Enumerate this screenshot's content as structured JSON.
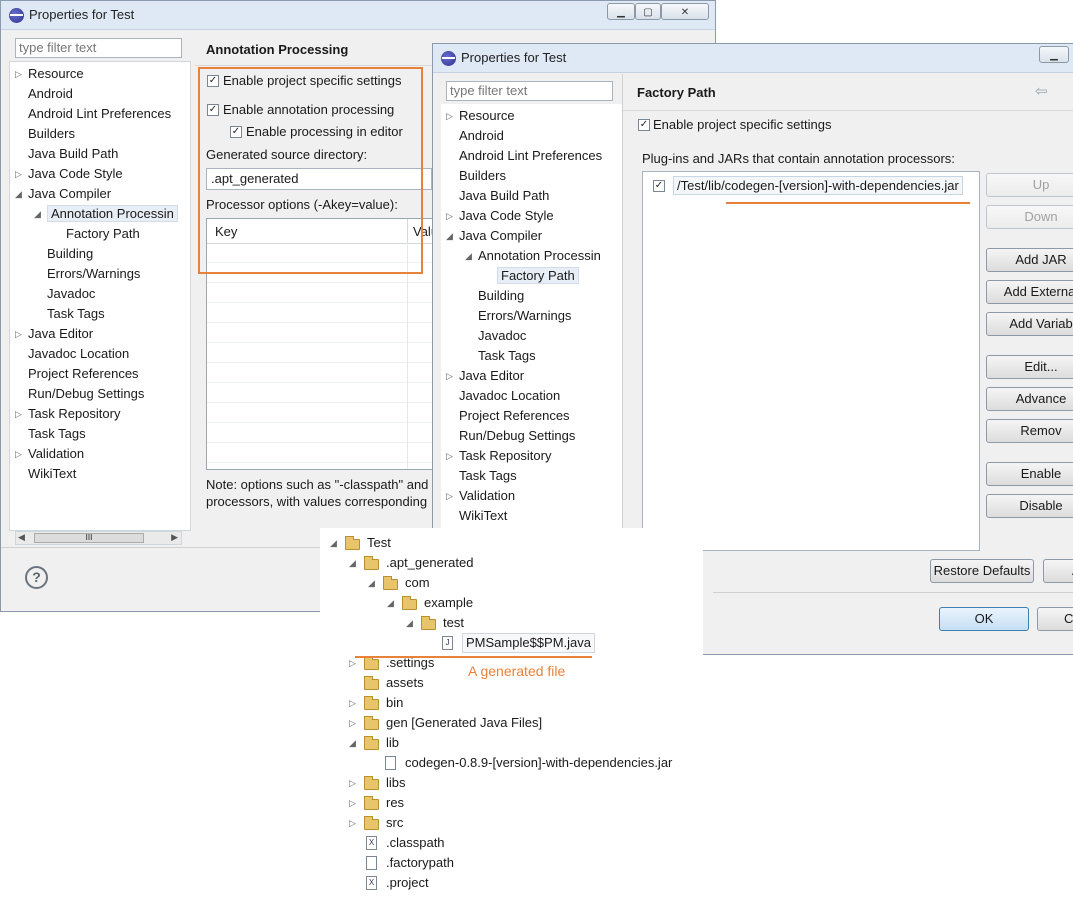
{
  "back_window": {
    "title": "Properties for Test",
    "filter_placeholder": "type filter text",
    "tree": [
      {
        "label": "Resource",
        "arrow": "▷"
      },
      {
        "label": "Android",
        "arrow": ""
      },
      {
        "label": "Android Lint Preferences",
        "arrow": ""
      },
      {
        "label": "Builders",
        "arrow": ""
      },
      {
        "label": "Java Build Path",
        "arrow": ""
      },
      {
        "label": "Java Code Style",
        "arrow": "▷"
      },
      {
        "label": "Java Compiler",
        "arrow": "◢"
      },
      {
        "label": "Annotation Processin",
        "arrow": "◢"
      },
      {
        "label": "Factory Path",
        "arrow": ""
      },
      {
        "label": "Building",
        "arrow": ""
      },
      {
        "label": "Errors/Warnings",
        "arrow": ""
      },
      {
        "label": "Javadoc",
        "arrow": ""
      },
      {
        "label": "Task Tags",
        "arrow": ""
      },
      {
        "label": "Java Editor",
        "arrow": "▷"
      },
      {
        "label": "Javadoc Location",
        "arrow": ""
      },
      {
        "label": "Project References",
        "arrow": ""
      },
      {
        "label": "Run/Debug Settings",
        "arrow": ""
      },
      {
        "label": "Task Repository",
        "arrow": "▷"
      },
      {
        "label": "Task Tags",
        "arrow": ""
      },
      {
        "label": "Validation",
        "arrow": "▷"
      },
      {
        "label": "WikiText",
        "arrow": ""
      }
    ],
    "panel_title": "Annotation Processing",
    "enable_project_specific": "Enable project specific settings",
    "enable_annotation": "Enable annotation processing",
    "enable_in_editor": "Enable processing in editor",
    "gen_dir_label": "Generated source directory:",
    "gen_dir_value": ".apt_generated",
    "proc_options_label": "Processor options (-Akey=value):",
    "col_key": "Key",
    "col_value": "Valu",
    "note_line1": "Note: options such as \"-classpath\" and",
    "note_line2": "processors, with values corresponding",
    "scroll_thumb": "III",
    "help_icon": "?"
  },
  "front_window": {
    "title": "Properties for Test",
    "filter_placeholder": "type filter text",
    "tree": [
      {
        "label": "Resource",
        "arrow": "▷"
      },
      {
        "label": "Android",
        "arrow": ""
      },
      {
        "label": "Android Lint Preferences",
        "arrow": ""
      },
      {
        "label": "Builders",
        "arrow": ""
      },
      {
        "label": "Java Build Path",
        "arrow": ""
      },
      {
        "label": "Java Code Style",
        "arrow": "▷"
      },
      {
        "label": "Java Compiler",
        "arrow": "◢"
      },
      {
        "label": "Annotation Processin",
        "arrow": "◢"
      },
      {
        "label": "Factory Path",
        "arrow": ""
      },
      {
        "label": "Building",
        "arrow": ""
      },
      {
        "label": "Errors/Warnings",
        "arrow": ""
      },
      {
        "label": "Javadoc",
        "arrow": ""
      },
      {
        "label": "Task Tags",
        "arrow": ""
      },
      {
        "label": "Java Editor",
        "arrow": "▷"
      },
      {
        "label": "Javadoc Location",
        "arrow": ""
      },
      {
        "label": "Project References",
        "arrow": ""
      },
      {
        "label": "Run/Debug Settings",
        "arrow": ""
      },
      {
        "label": "Task Repository",
        "arrow": "▷"
      },
      {
        "label": "Task Tags",
        "arrow": ""
      },
      {
        "label": "Validation",
        "arrow": "▷"
      },
      {
        "label": "WikiText",
        "arrow": ""
      }
    ],
    "panel_title": "Factory Path",
    "enable_project_specific": "Enable project specific settings",
    "plugins_label": "Plug-ins and JARs that contain annotation processors:",
    "jar_entry": "/Test/lib/codegen-[version]-with-dependencies.jar",
    "buttons": [
      "Up",
      "Down",
      "Add JAR",
      "Add External",
      "Add Variab",
      "Edit...",
      "Advance",
      "Remov",
      "Enable",
      "Disable"
    ],
    "restore_defaults": "Restore Defaults",
    "apply": "A",
    "ok": "OK",
    "cancel": "Ca",
    "back_arrow": "⇦"
  },
  "explorer": {
    "items": [
      {
        "label": "Test",
        "arrow": "◢",
        "icon": "project"
      },
      {
        "label": ".apt_generated",
        "arrow": "◢",
        "icon": "folder"
      },
      {
        "label": "com",
        "arrow": "◢",
        "icon": "folder"
      },
      {
        "label": "example",
        "arrow": "◢",
        "icon": "folder"
      },
      {
        "label": "test",
        "arrow": "◢",
        "icon": "folder"
      },
      {
        "label": "PMSample$$PM.java",
        "arrow": "",
        "icon": "java"
      },
      {
        "label": ".settings",
        "arrow": "▷",
        "icon": "folder"
      },
      {
        "label": "assets",
        "arrow": "",
        "icon": "folder"
      },
      {
        "label": "bin",
        "arrow": "▷",
        "icon": "folder"
      },
      {
        "label": "gen [Generated Java Files]",
        "arrow": "▷",
        "icon": "folder"
      },
      {
        "label": "lib",
        "arrow": "◢",
        "icon": "folder"
      },
      {
        "label": "codegen-0.8.9-[version]-with-dependencies.jar",
        "arrow": "",
        "icon": "jar"
      },
      {
        "label": "libs",
        "arrow": "▷",
        "icon": "folder"
      },
      {
        "label": "res",
        "arrow": "▷",
        "icon": "folder"
      },
      {
        "label": "src",
        "arrow": "▷",
        "icon": "folder"
      },
      {
        "label": ".classpath",
        "arrow": "",
        "icon": "xfile"
      },
      {
        "label": ".factorypath",
        "arrow": "",
        "icon": "file"
      },
      {
        "label": ".project",
        "arrow": "",
        "icon": "xfile"
      }
    ],
    "annotation": "A generated file"
  },
  "colors": {
    "highlight": "#e8823a"
  }
}
